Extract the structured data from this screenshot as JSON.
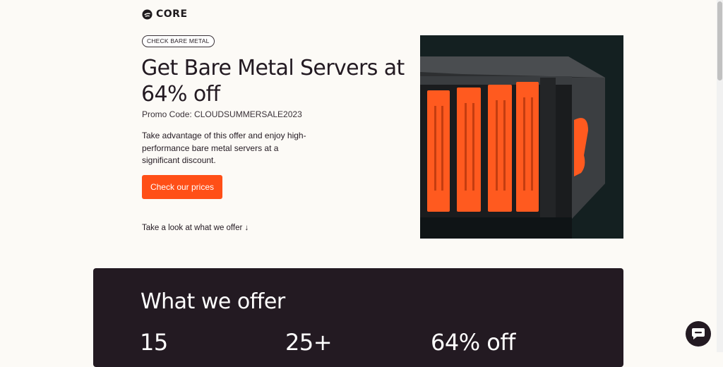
{
  "brand": {
    "name": "CORE"
  },
  "hero": {
    "badge": "CHECK BARE METAL",
    "headline": "Get Bare Metal Servers at 64% off",
    "promo": "Promo Code: CLOUDSUMMERSALE2023",
    "description": "Take advantage of this offer and enjoy high-performance bare metal servers at a significant discount.",
    "cta_label": "Check our prices",
    "scroll_link": "Take a look at what we offer ↓"
  },
  "offer": {
    "title": "What we offer",
    "stats": [
      "15",
      "25+",
      "64% off"
    ]
  },
  "colors": {
    "accent": "#ff4f17",
    "dark": "#231a22",
    "background": "#fcfaf6"
  },
  "icons": {
    "logo": "core-logo-icon",
    "chat": "chat-bubble-icon"
  }
}
